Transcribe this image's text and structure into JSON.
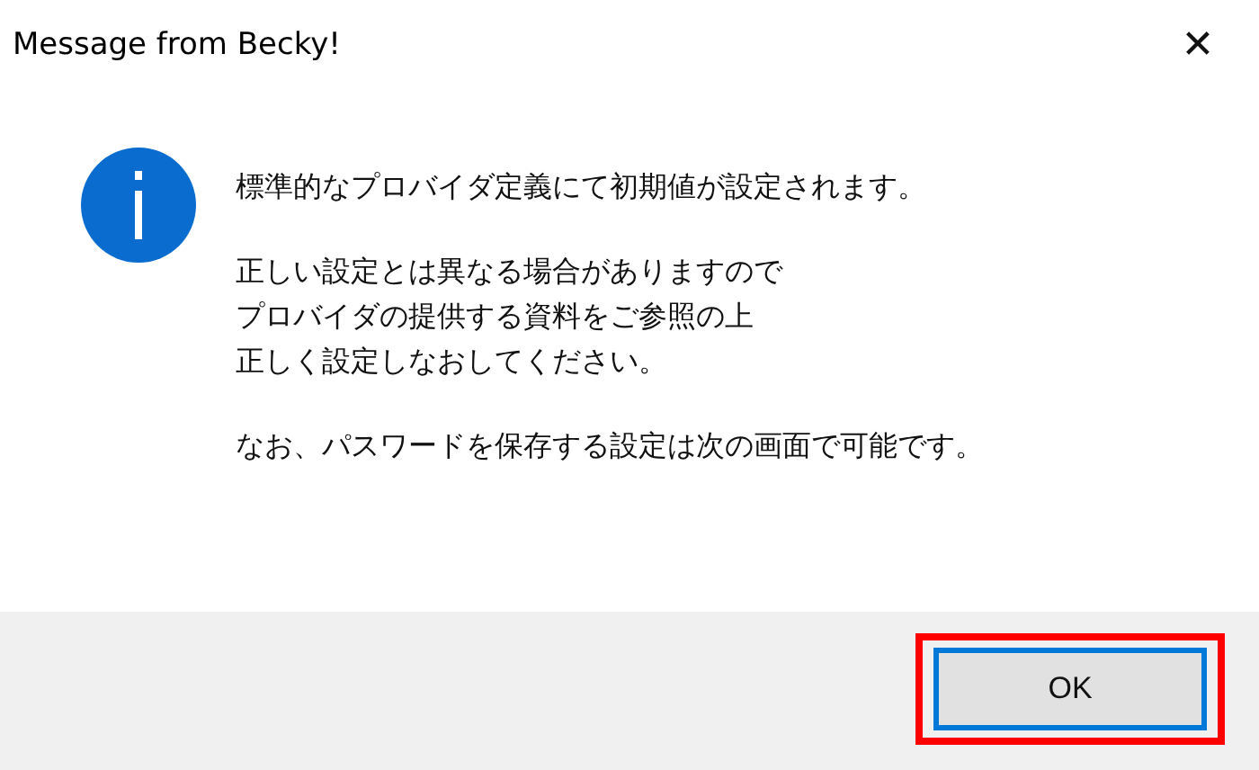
{
  "window": {
    "title": "Message from Becky!",
    "close": "✕"
  },
  "message": {
    "paragraphs": [
      [
        "標準的なプロバイダ定義にて初期値が設定されます。"
      ],
      [
        "正しい設定とは異なる場合がありますので",
        "プロバイダの提供する資料をご参照の上",
        "正しく設定しなおしてください。"
      ],
      [
        "なお、パスワードを保存する設定は次の画面で可能です。"
      ]
    ]
  },
  "buttons": [
    {
      "label": "OK",
      "focused": true,
      "highlighted": true
    }
  ]
}
